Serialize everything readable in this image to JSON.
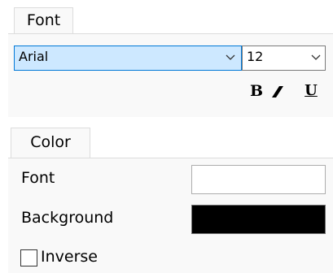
{
  "font_section": {
    "tab_label": "Font",
    "family": {
      "value": "Arial"
    },
    "size": {
      "value": "12"
    },
    "style_buttons": {
      "bold": "B",
      "italic": "/",
      "underline": "U"
    }
  },
  "color_section": {
    "tab_label": "Color",
    "font_label": "Font",
    "font_color": "#ffffff",
    "background_label": "Background",
    "background_color": "#000000",
    "inverse": {
      "label": "Inverse",
      "checked": false
    }
  },
  "icons": {
    "dropdown": "chevron-down-icon"
  },
  "colors": {
    "selected_field_bg": "#cde8ff",
    "focus_border": "#0078d7"
  }
}
